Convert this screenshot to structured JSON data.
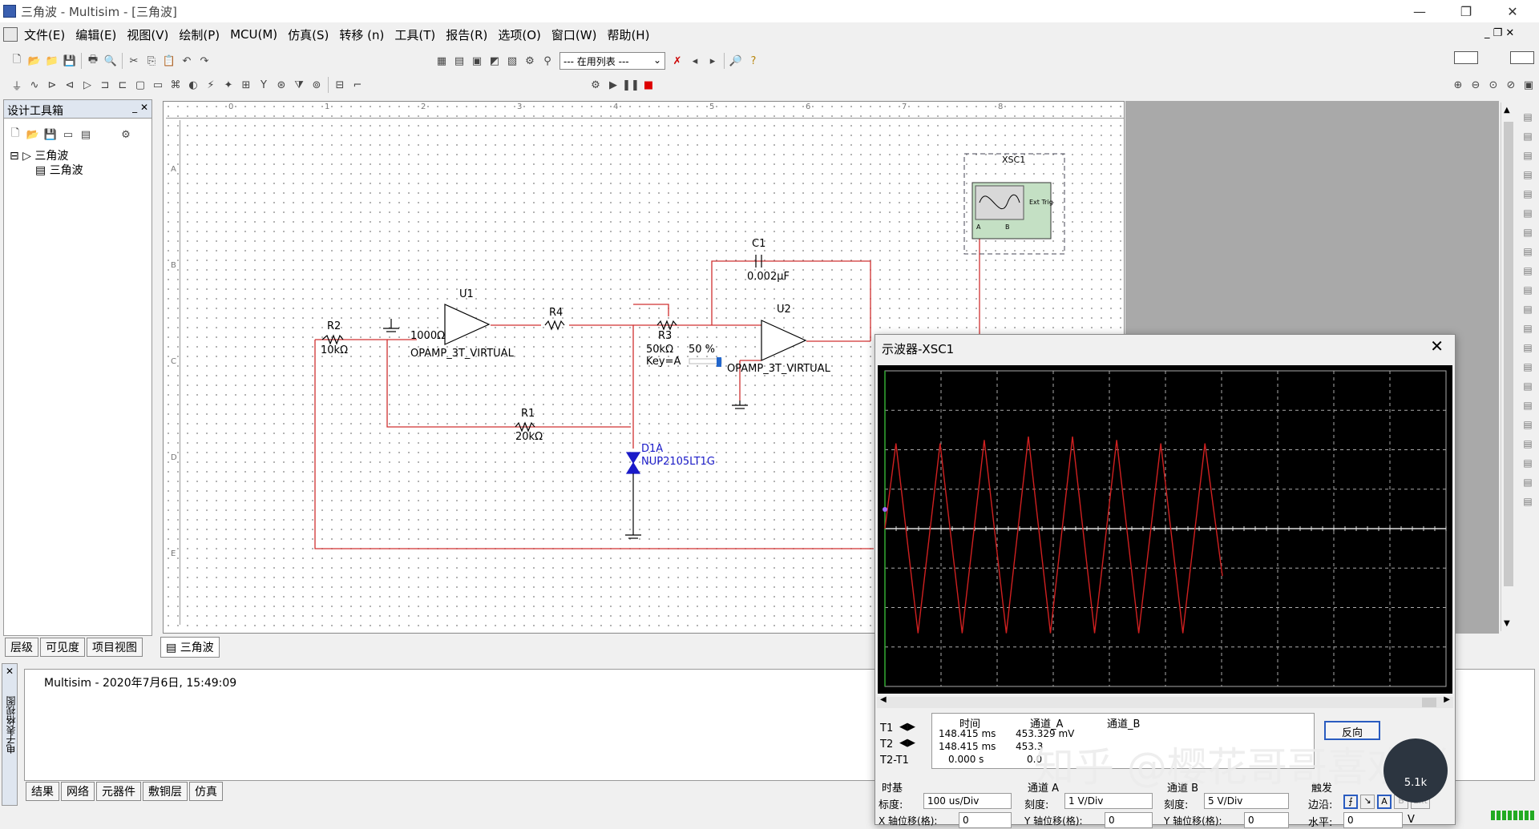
{
  "window": {
    "title": "三角波 - Multisim - [三角波]"
  },
  "menu": [
    "文件(E)",
    "编辑(E)",
    "视图(V)",
    "绘制(P)",
    "MCU(M)",
    "仿真(S)",
    "转移 (n)",
    "工具(T)",
    "报告(R)",
    "选项(O)",
    "窗口(W)",
    "帮助(H)"
  ],
  "toolbar": {
    "in_use_list": "--- 在用列表 ---"
  },
  "toolbox": {
    "title": "设计工具箱",
    "tree_root": "三角波",
    "tree_child": "三角波",
    "tabs": [
      "层级",
      "可见度",
      "项目视图"
    ]
  },
  "schematic": {
    "sheet_tab": "三角波",
    "components": {
      "u1": "U1",
      "u1_model": "OPAMP_3T_VIRTUAL",
      "u1_res": "1000Ω",
      "u2": "U2",
      "u2_model": "OPAMP_3T_VIRTUAL",
      "r2": "R2",
      "r2_val": "10kΩ",
      "r4": "R4",
      "r3": "R3",
      "r3_val": "50kΩ",
      "r3_key": "Key=A",
      "r3_pct": "50 %",
      "r1": "R1",
      "r1_val": "20kΩ",
      "c1": "C1",
      "c1_val": "0.002µF",
      "d1": "D1A",
      "d1_model": "NUP2105LT1G",
      "xsc": "XSC1",
      "ext_trig": "Ext Trig",
      "ch_a": "A",
      "ch_b": "B"
    },
    "ruler_cols": [
      "0",
      "1",
      "2",
      "3",
      "4",
      "5",
      "6",
      "7",
      "8"
    ],
    "ruler_rows": [
      "A",
      "B",
      "C",
      "D",
      "E"
    ]
  },
  "scope": {
    "title": "示波器-XSC1",
    "table_headers": [
      "时间",
      "通道_A",
      "通道_B"
    ],
    "rows": [
      {
        "label": "T1",
        "time": "148.415 ms",
        "a": "453.329 mV",
        "b": ""
      },
      {
        "label": "T2",
        "time": "148.415 ms",
        "a": "453.3",
        "b": ""
      },
      {
        "label": "T2-T1",
        "time": "0.000 s",
        "a": "0.0",
        "b": ""
      }
    ],
    "reverse_button": "反向",
    "timebase": {
      "label": "时基",
      "scale_label": "标度:",
      "scale": "100 us/Div",
      "xpos_label": "X 轴位移(格):",
      "xpos": "0"
    },
    "channel_a": {
      "label": "通道 A",
      "scale_label": "刻度:",
      "scale": "1 V/Div",
      "ypos_label": "Y 轴位移(格):",
      "ypos": "0"
    },
    "channel_b": {
      "label": "通道 B",
      "scale_label": "刻度:",
      "scale": "5 V/Div",
      "ypos_label": "Y 轴位移(格):",
      "ypos": "0"
    },
    "trigger": {
      "label": "触发",
      "edge_label": "边沿:",
      "level_label": "水平:",
      "level": "0",
      "level_unit": "V",
      "buttons": [
        "A",
        "B",
        "Ext"
      ]
    },
    "trace_color": "#d02020",
    "waveform_peaks": [
      0.75,
      0.92,
      0.75,
      0.92,
      0.78,
      0.92,
      0.81,
      0.92,
      0.81,
      0.92,
      0.78,
      0.92,
      0.75,
      0.92,
      0.75
    ]
  },
  "output": {
    "message": "Multisim  -  2020年7月6日, 15:49:09",
    "side_label": "电子表格视图",
    "tabs": [
      "结果",
      "网络",
      "元器件",
      "敷铜层",
      "仿真"
    ]
  },
  "watermark": "知乎 @樱花哥哥喜欢吖",
  "badge": "5.1k"
}
